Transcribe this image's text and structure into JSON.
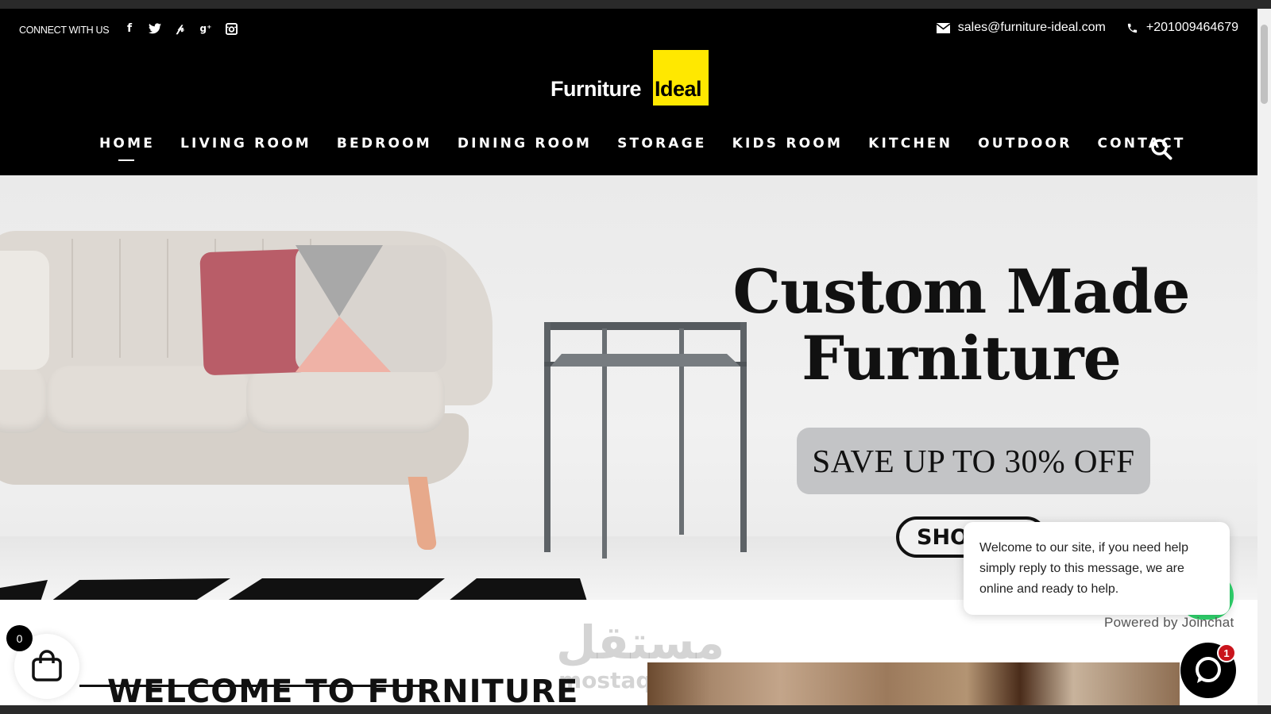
{
  "topbar": {
    "connect_label": "CONNECT WITH US",
    "socials": [
      "facebook-icon",
      "twitter-icon",
      "pinterest-icon",
      "google-plus-icon",
      "instagram-icon"
    ],
    "email": "sales@furniture-ideal.com",
    "phone": "+201009464679"
  },
  "logo": {
    "word1": "Furniture",
    "word2": "Ideal",
    "accent": "#ffe800"
  },
  "nav": {
    "items": [
      "HOME",
      "LIVING ROOM",
      "BEDROOM",
      "DINING ROOM",
      "STORAGE",
      "KIDS ROOM",
      "KITCHEN",
      "OUTDOOR",
      "CONTACT"
    ],
    "active": "HOME"
  },
  "hero": {
    "title_line1": "Custom Made",
    "title_line2": "Furniture",
    "save_text": "SAVE UP TO 30% OFF",
    "shop_label": "SHOI"
  },
  "chat": {
    "message": "Welcome to our site, if you need help simply reply to this message, we are online and ready to help.",
    "powered": "Powered by Joinchat",
    "badge": "1",
    "accent": "#25d366"
  },
  "cart": {
    "count": "0"
  },
  "welcome": {
    "heading": "WELCOME TO FURNITURE"
  },
  "watermark": {
    "arabic": "مستقل",
    "latin": "mostaql.com"
  }
}
